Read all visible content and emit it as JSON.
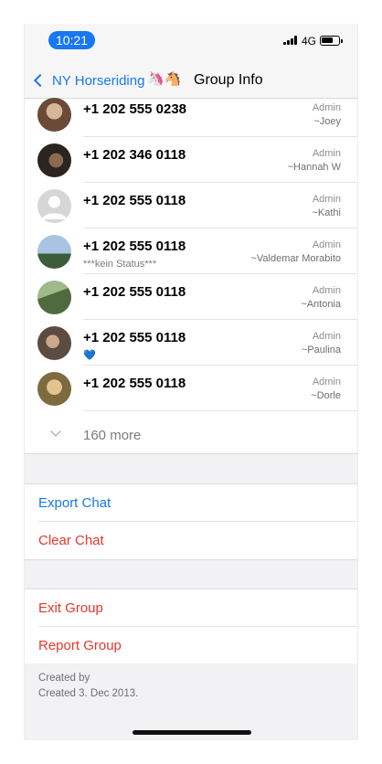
{
  "status_bar": {
    "time": "10:21",
    "network": "4G"
  },
  "nav": {
    "back_label": "NY Horseriding",
    "emojis": "🦄🐴",
    "title": "Group Info"
  },
  "members": [
    {
      "phone": "+1 202 555 0238",
      "status": "",
      "role": "Admin",
      "nickname": "~Joey",
      "avatar_color": "#8a6a55"
    },
    {
      "phone": "+1 202 346 0118",
      "status": "",
      "role": "Admin",
      "nickname": "~Hannah W",
      "avatar_color": "#4a3b33"
    },
    {
      "phone": "+1 202 555 0118",
      "status": "",
      "role": "Admin",
      "nickname": "~Kathi",
      "avatar_color": "#d5d5d8"
    },
    {
      "phone": "+1 202 555 0118",
      "status": "***kein Status***",
      "role": "Admin",
      "nickname": "~Valdemar Morabito",
      "avatar_color": "#6d8db5"
    },
    {
      "phone": "+1 202 555 0118",
      "status": "",
      "role": "Admin",
      "nickname": "~Antonia",
      "avatar_color": "#5f7a4e"
    },
    {
      "phone": "+1 202 555 0118",
      "status": "💙",
      "role": "Admin",
      "nickname": "~Paulina",
      "avatar_color": "#7c6b5e"
    },
    {
      "phone": "+1 202 555 0118",
      "status": "",
      "role": "Admin",
      "nickname": "~Dorle",
      "avatar_color": "#b08e5a"
    }
  ],
  "more_label": "160 more",
  "actions_group_1": [
    {
      "label": "Export Chat",
      "color": "#1877f2"
    },
    {
      "label": "Clear Chat",
      "color": "#e8352b"
    }
  ],
  "actions_group_2": [
    {
      "label": "Exit Group",
      "color": "#e8352b"
    },
    {
      "label": "Report Group",
      "color": "#e8352b"
    }
  ],
  "footer": {
    "created_by": "Created by",
    "created_date": "Created 3. Dec 2013."
  }
}
